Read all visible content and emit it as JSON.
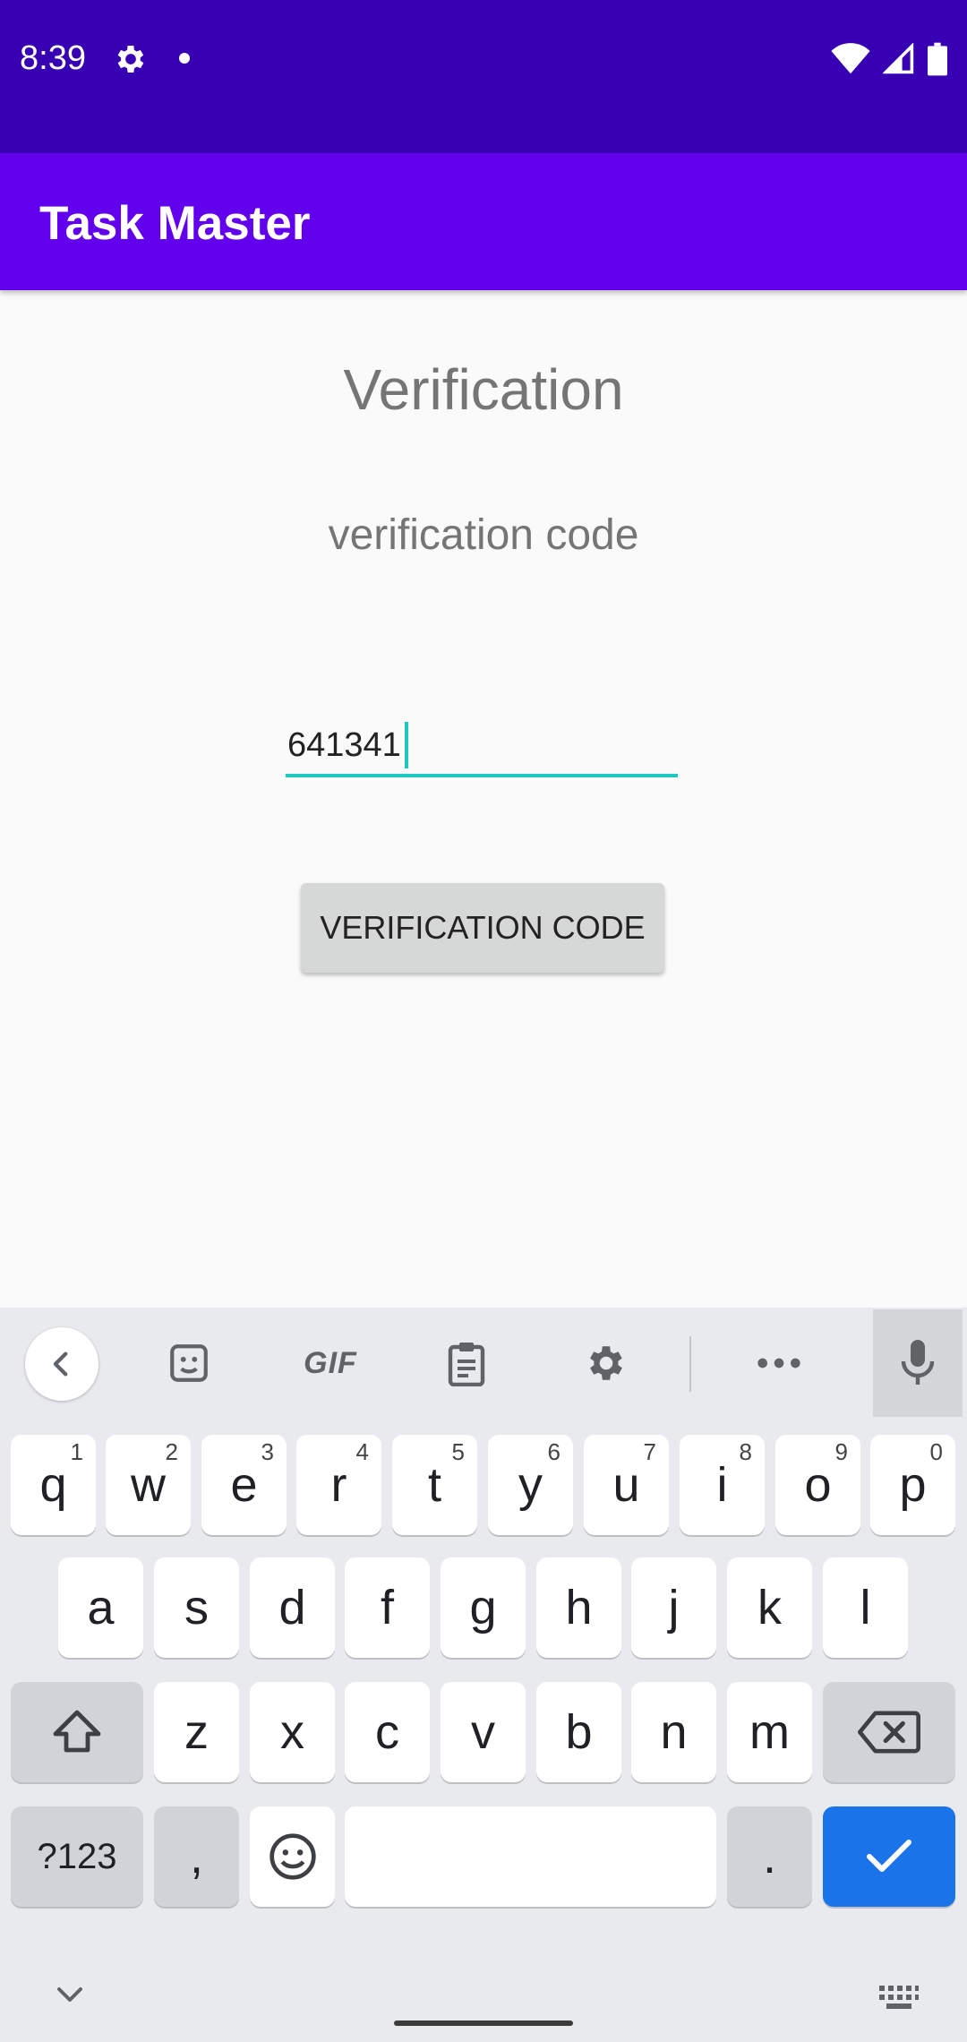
{
  "status_bar": {
    "time": "8:39",
    "icons": [
      "settings-icon",
      "notification-dot",
      "wifi-icon",
      "signal-icon",
      "battery-icon"
    ],
    "bg_color": "#3700b3"
  },
  "app_bar": {
    "title": "Task Master",
    "bg_color": "#6200ee"
  },
  "screen": {
    "title": "Verification",
    "subtitle": "verification code",
    "code_input_value": "641341",
    "verify_button_label": "VERIFICATION CODE",
    "accent_color": "#1ec8c0"
  },
  "keyboard": {
    "toolbar_icons": [
      "back-icon",
      "sticker-icon",
      "gif-icon",
      "clipboard-icon",
      "settings-icon",
      "more-icon",
      "mic-icon"
    ],
    "gif_label": "GIF",
    "row1": [
      {
        "key": "q",
        "hint": "1"
      },
      {
        "key": "w",
        "hint": "2"
      },
      {
        "key": "e",
        "hint": "3"
      },
      {
        "key": "r",
        "hint": "4"
      },
      {
        "key": "t",
        "hint": "5"
      },
      {
        "key": "y",
        "hint": "6"
      },
      {
        "key": "u",
        "hint": "7"
      },
      {
        "key": "i",
        "hint": "8"
      },
      {
        "key": "o",
        "hint": "9"
      },
      {
        "key": "p",
        "hint": "0"
      }
    ],
    "row2": [
      "a",
      "s",
      "d",
      "f",
      "g",
      "h",
      "j",
      "k",
      "l"
    ],
    "row3": [
      "z",
      "x",
      "c",
      "v",
      "b",
      "n",
      "m"
    ],
    "symbols_label": "?123",
    "comma_label": ",",
    "period_label": ".",
    "action_color": "#1a73e8"
  }
}
